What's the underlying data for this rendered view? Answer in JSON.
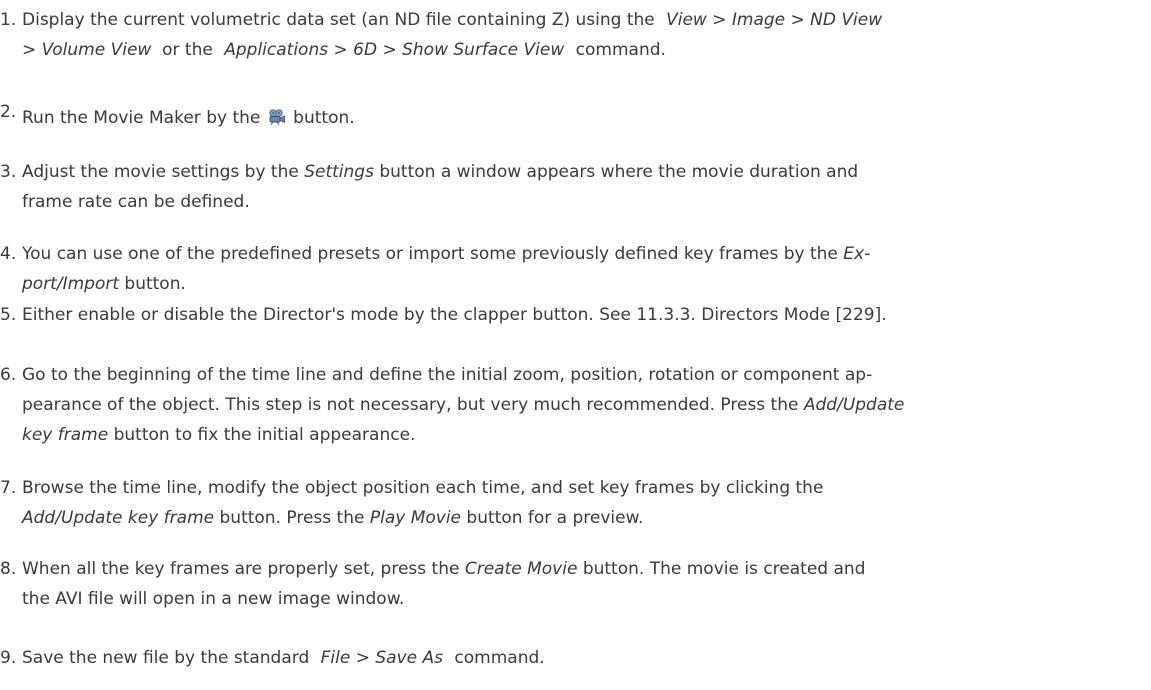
{
  "steps": [
    {
      "num": "1.",
      "lines": [
        [
          "Display the current volumetric data set (an ND file containing Z) using the",
          "View > Image > ND View"
        ],
        [
          "> Volume View",
          "or the",
          "Applications > 6D > Show Surface View",
          "command."
        ]
      ]
    },
    {
      "num": "2.",
      "before": "Run the Movie Maker by the",
      "icon": "movie-camera-icon",
      "after": "button."
    },
    {
      "num": "3.",
      "l1_pre": "Adjust the movie settings by the",
      "l1_em": "Settings",
      "l1_post": "button a window appears where the movie duration and",
      "l2": "frame rate can be defined."
    },
    {
      "num": "4.",
      "l1_pre": "You can use one of the predefined presets or import some previously defined key frames by the",
      "l1_em": "Ex-",
      "l2_em": "port/Import",
      "l2_post": "button."
    },
    {
      "num": "5.",
      "text": "Either enable or disable the Director's mode by the clapper button. See 11.3.3. Directors Mode [229]."
    },
    {
      "num": "6.",
      "l1": "Go to the beginning of the time line and define the initial zoom, position, rotation or component ap-",
      "l2_pre": "pearance of the object. This step is not necessary, but very much recommended. Press the",
      "l2_em": "Add/Update",
      "l3_em": "key frame",
      "l3_post": "button to fix the initial appearance."
    },
    {
      "num": "7.",
      "l1": "Browse the time line, modify the object position each time, and set key frames by clicking the",
      "l2_em1": "Add/Update key frame",
      "l2_mid": "button. Press the",
      "l2_em2": "Play Movie",
      "l2_post": "button for a preview."
    },
    {
      "num": "8.",
      "l1_pre": "When all the key frames are properly set, press the",
      "l1_em": "Create Movie",
      "l1_post": "button. The movie is created and",
      "l2": "the AVI file will open in a new image window."
    },
    {
      "num": "9.",
      "pre": "Save the new file by the standard",
      "em": "File > Save As",
      "post": "command."
    }
  ]
}
